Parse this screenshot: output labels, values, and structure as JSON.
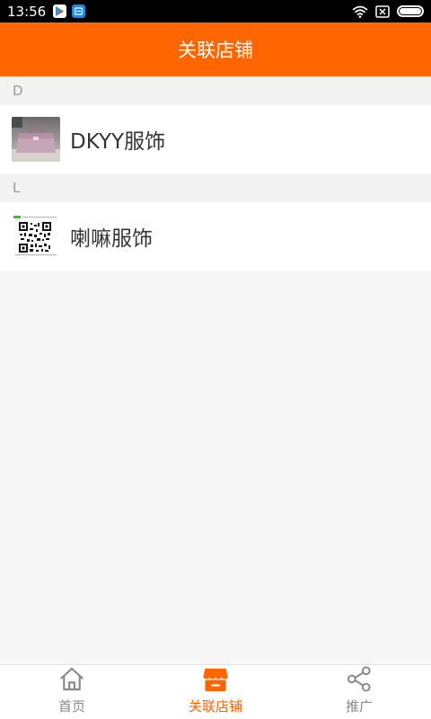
{
  "status_bar": {
    "time": "13:56"
  },
  "header": {
    "title": "关联店铺"
  },
  "sections": [
    {
      "letter": "D",
      "shops": [
        {
          "name": "DKYY服饰",
          "thumbnail": "handbag-photo"
        }
      ]
    },
    {
      "letter": "L",
      "shops": [
        {
          "name": "喇嘛服饰",
          "thumbnail": "qr-code-image"
        }
      ]
    }
  ],
  "bottom_nav": {
    "items": [
      {
        "label": "首页",
        "icon": "home-icon",
        "active": false
      },
      {
        "label": "关联店铺",
        "icon": "store-icon",
        "active": true
      },
      {
        "label": "推广",
        "icon": "share-icon",
        "active": false
      }
    ]
  },
  "colors": {
    "accent": "#ff6600",
    "status_bar_bg": "#000000",
    "section_bg": "#f2f2f2",
    "inactive_nav": "#888888"
  }
}
